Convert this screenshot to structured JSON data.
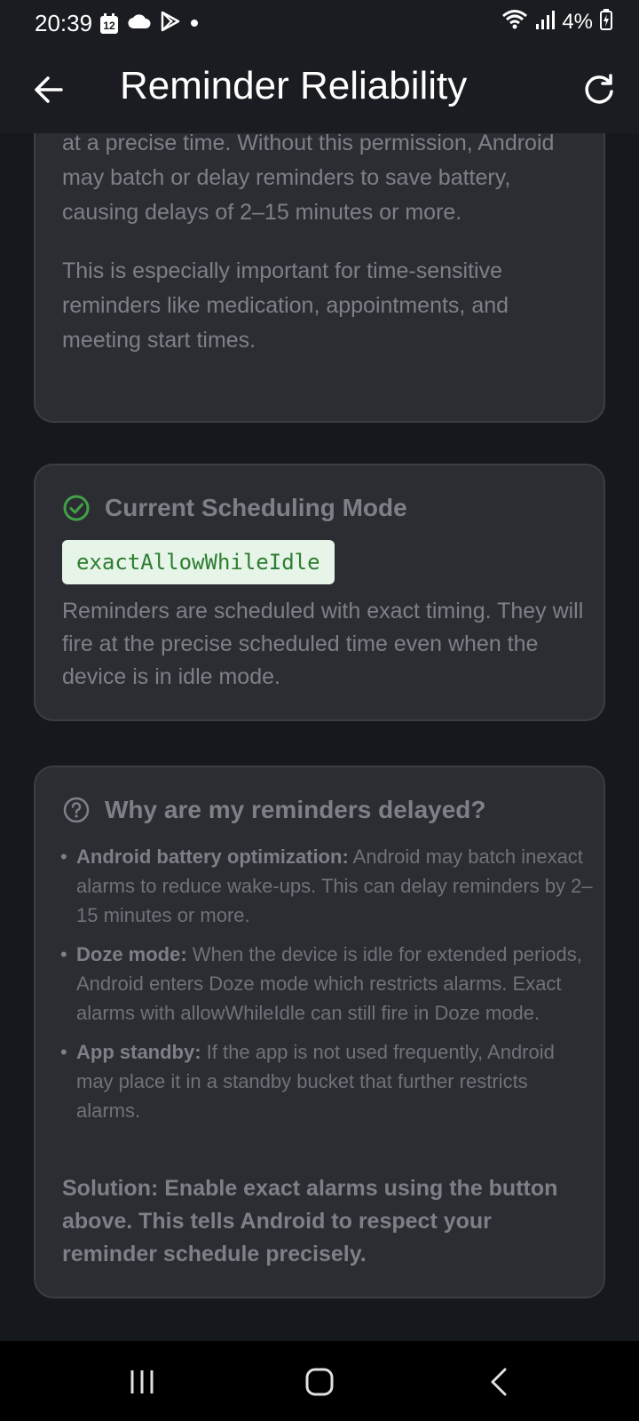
{
  "status_bar": {
    "time": "20:39",
    "calendar_day": "12",
    "battery": "4%"
  },
  "app_bar": {
    "title": "Reminder Reliability"
  },
  "permission_card": {
    "paragraph1": "at a precise time. Without this permission, Android may batch or delay reminders to save battery, causing delays of 2–15 minutes or more.",
    "paragraph2": "This is especially important for time-sensitive reminders like medication, appointments, and meeting start times."
  },
  "scheduling_card": {
    "title": "Current Scheduling Mode",
    "mode": "exactAllowWhileIdle",
    "description": "Reminders are scheduled with exact timing. They will fire at the precise scheduled time even when the device is in idle mode."
  },
  "faq_card": {
    "title": "Why are my reminders delayed?",
    "items": [
      {
        "term": "Android battery optimization:",
        "text": " Android may batch inexact alarms to reduce wake-ups. This can delay reminders by 2–15 minutes or more."
      },
      {
        "term": "Doze mode:",
        "text": " When the device is idle for extended periods, Android enters Doze mode which restricts alarms. Exact alarms with allowWhileIdle can still fire in Doze mode."
      },
      {
        "term": "App standby:",
        "text": " If the app is not used frequently, Android may place it in a standby bucket that further restricts alarms."
      }
    ],
    "solution": "Solution: Enable exact alarms using the button above. This tells Android to respect your reminder schedule precisely."
  },
  "colors": {
    "background": "#15181d",
    "card": "#2b2d33",
    "success_green": "#43a047",
    "chip_bg": "#e6f5e8",
    "chip_text": "#2e7d32"
  },
  "icons": {
    "back": "arrow-left-icon",
    "refresh": "refresh-icon",
    "success": "check-circle-icon",
    "help": "help-circle-icon"
  }
}
